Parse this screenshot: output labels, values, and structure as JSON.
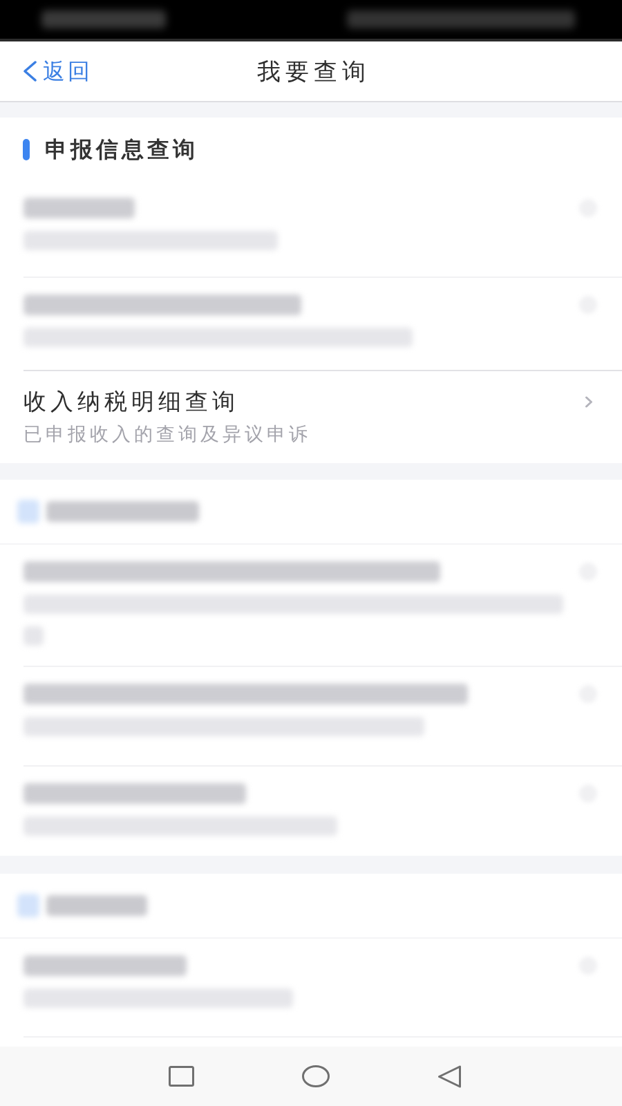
{
  "status_bar": {
    "kind": "blurred"
  },
  "nav_bar": {
    "back": "返回",
    "title": "我要查询"
  },
  "sections": [
    {
      "header": {
        "kind": "text",
        "label": "申报信息查询"
      },
      "items": [
        {
          "kind": "blurred"
        },
        {
          "kind": "blurred"
        },
        {
          "kind": "entry",
          "title": "收入纳税明细查询",
          "subtitle": "已申报收入的查询及异议申诉"
        }
      ]
    },
    {
      "header": {
        "kind": "blurred"
      },
      "items": [
        {
          "kind": "blurred"
        },
        {
          "kind": "blurred"
        },
        {
          "kind": "blurred"
        }
      ]
    },
    {
      "header": {
        "kind": "blurred"
      },
      "items": [
        {
          "kind": "blurred"
        }
      ]
    }
  ]
}
